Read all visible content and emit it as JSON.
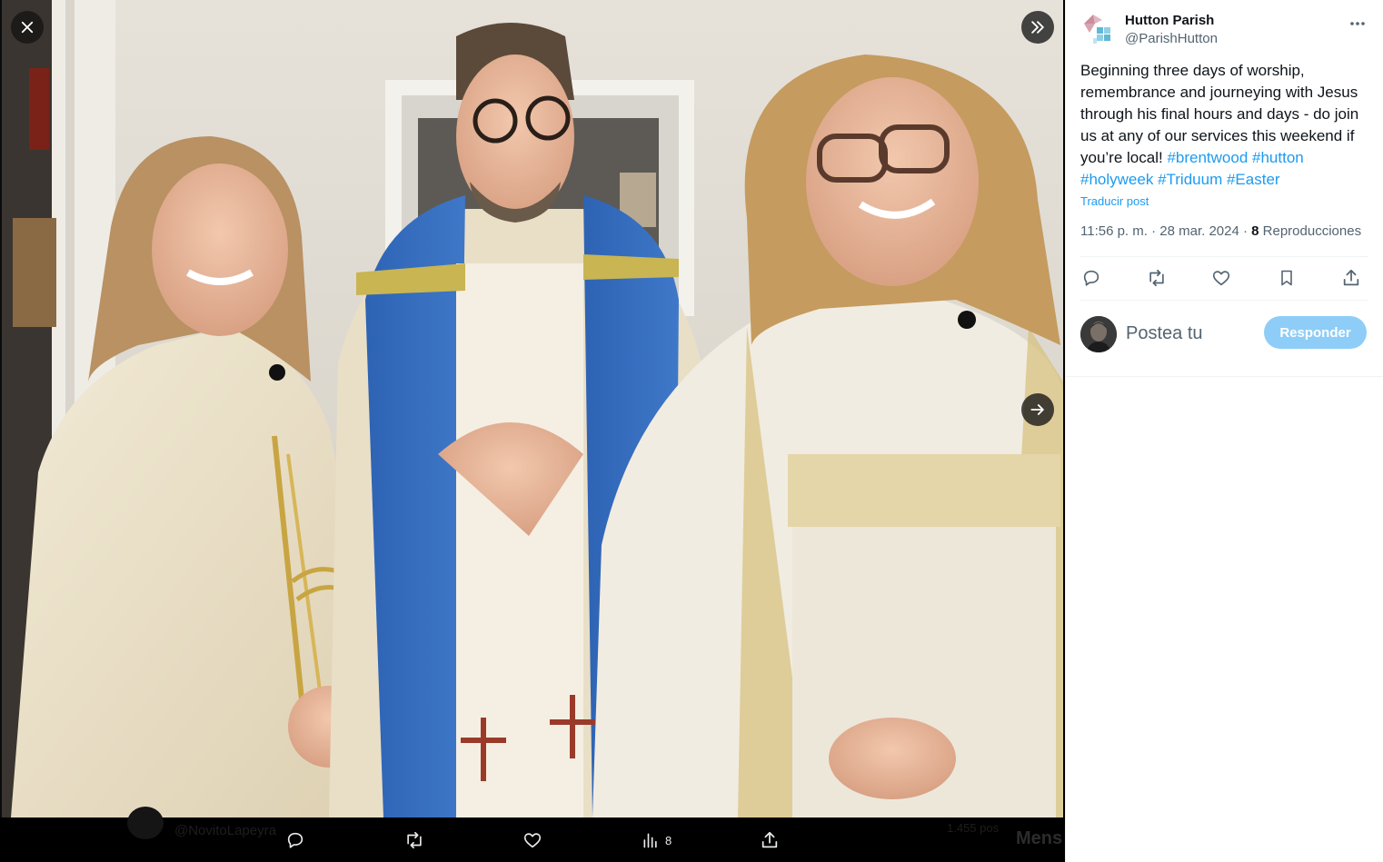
{
  "viewer": {
    "close_icon": "close-icon",
    "collapse_icon": "double-chevron-right-icon",
    "next_icon": "arrow-right-icon",
    "photo_people": [
      {
        "role": "priest-left",
        "vestment": "cream chasuble"
      },
      {
        "role": "priest-center",
        "vestment": "blue cope over white surplice"
      },
      {
        "role": "priest-right",
        "vestment": "white dalmatic with gold trim"
      }
    ]
  },
  "action_bar": {
    "background_handle": "@NovitoLapeyra",
    "background_right": "1.455 pos",
    "background_mens": "Mens",
    "actions": [
      {
        "icon": "reply-icon",
        "count": ""
      },
      {
        "icon": "repost-icon",
        "count": ""
      },
      {
        "icon": "like-icon",
        "count": ""
      },
      {
        "icon": "views-icon",
        "count": "8"
      },
      {
        "icon": "share-icon",
        "count": ""
      }
    ]
  },
  "post": {
    "author_name": "Hutton Parish",
    "author_handle": "@ParishHutton",
    "text_main": "Beginning three days of worship, remembrance and journeying with Jesus through his final hours and days - do join us at any of our services this weekend if you’re local! ",
    "hashtags": [
      "#brentwood",
      "#hutton",
      "#holyweek",
      "#Triduum",
      "#Easter"
    ],
    "translate_label": "Traducir post",
    "timestamp": "11:56 p. m. · 28 mar. 2024 · ",
    "views_count": "8",
    "views_label": " Reproducciones"
  },
  "reply": {
    "placeholder": "Postea tu",
    "button_label": "Responder"
  },
  "colors": {
    "accent": "#1d9bf0",
    "reply_button_disabled": "#8ecdf7",
    "text_primary": "#0f1419",
    "text_secondary": "#536471"
  }
}
